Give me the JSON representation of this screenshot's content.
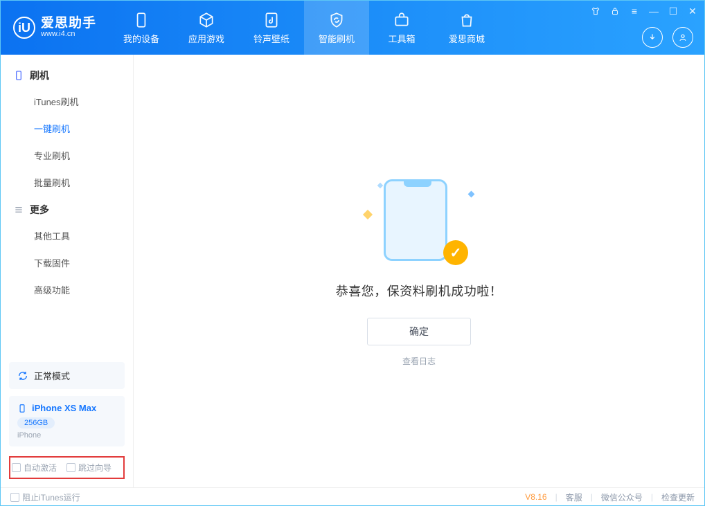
{
  "app": {
    "name_cn": "爱思助手",
    "url": "www.i4.cn"
  },
  "tabs": [
    {
      "label": "我的设备"
    },
    {
      "label": "应用游戏"
    },
    {
      "label": "铃声壁纸"
    },
    {
      "label": "智能刷机"
    },
    {
      "label": "工具箱"
    },
    {
      "label": "爱思商城"
    }
  ],
  "sidebar": {
    "group1_label": "刷机",
    "items1": [
      {
        "label": "iTunes刷机"
      },
      {
        "label": "一键刷机"
      },
      {
        "label": "专业刷机"
      },
      {
        "label": "批量刷机"
      }
    ],
    "group2_label": "更多",
    "items2": [
      {
        "label": "其他工具"
      },
      {
        "label": "下载固件"
      },
      {
        "label": "高级功能"
      }
    ],
    "mode": "正常模式",
    "device": {
      "name": "iPhone XS Max",
      "capacity": "256GB",
      "type": "iPhone"
    },
    "opts": {
      "auto_activate": "自动激活",
      "skip_guide": "跳过向导"
    }
  },
  "main": {
    "success_msg": "恭喜您，保资料刷机成功啦！",
    "ok_btn": "确定",
    "view_log": "查看日志"
  },
  "footer": {
    "block_itunes": "阻止iTunes运行",
    "version": "V8.16",
    "support": "客服",
    "wechat": "微信公众号",
    "check_update": "检查更新"
  }
}
